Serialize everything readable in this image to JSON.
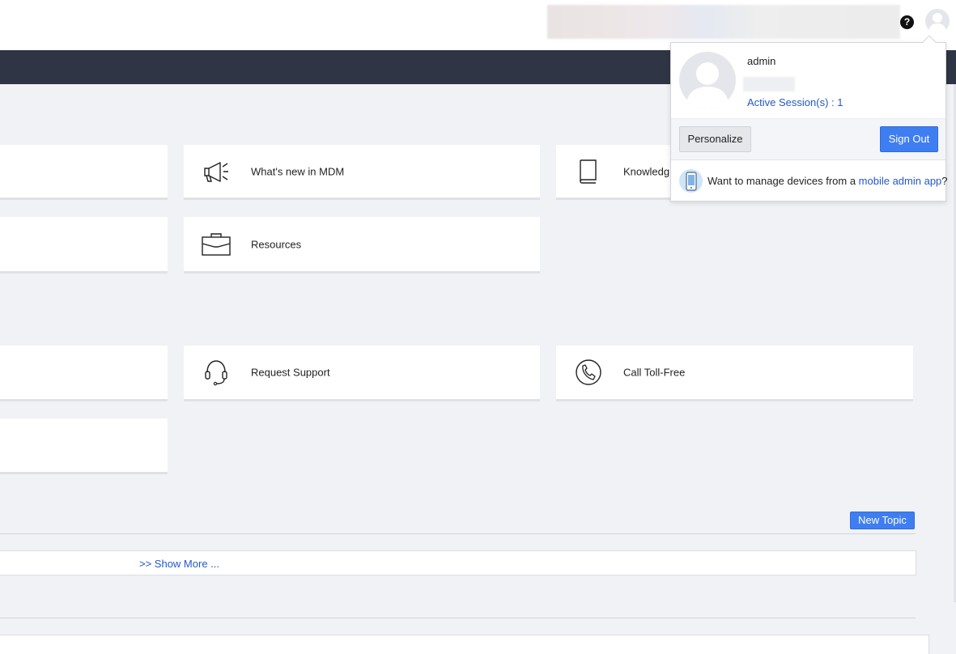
{
  "header": {
    "help_icon": "question-circle-icon",
    "help_glyph": "?"
  },
  "cards": {
    "whats_new": {
      "label": "What's new in MDM",
      "icon": "megaphone-icon"
    },
    "knowledge": {
      "label": "Knowledg",
      "icon": "book-icon"
    },
    "resources": {
      "label": "Resources",
      "icon": "briefcase-icon"
    },
    "request_support": {
      "label": "Request Support",
      "icon": "headset-icon"
    },
    "call_toll_free": {
      "label": "Call Toll-Free",
      "icon": "phone-call-icon"
    }
  },
  "forum": {
    "new_topic_label": "New Topic",
    "show_more_label": ">> Show More ..."
  },
  "user_menu": {
    "username": "admin",
    "active_sessions": "Active Session(s) : 1",
    "personalize_label": "Personalize",
    "sign_out_label": "Sign Out",
    "mobile_prompt_prefix": "Want to manage devices from a ",
    "mobile_link": "mobile admin app",
    "mobile_prompt_suffix": "?"
  },
  "colors": {
    "navbar": "#2f3545",
    "page_bg": "#f1f2f6",
    "primary_button": "#3f7ef0",
    "link": "#2458c7"
  }
}
